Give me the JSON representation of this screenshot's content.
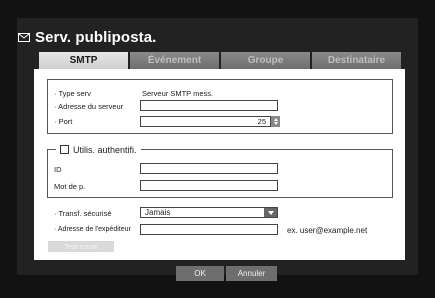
{
  "window": {
    "title": "Serv. publiposta.",
    "icon": "mail-icon"
  },
  "tabs": [
    {
      "label": "SMTP",
      "active": true
    },
    {
      "label": "Événement",
      "active": false
    },
    {
      "label": "Groupe",
      "active": false
    },
    {
      "label": "Destinataire",
      "active": false
    }
  ],
  "smtp": {
    "type_label": "· Type serv",
    "type_value": "Serveur SMTP mess.",
    "address_label": "· Adresse du serveur",
    "address_value": "",
    "port_label": "· Port",
    "port_value": "25"
  },
  "auth": {
    "checkbox_label": "Utilis. authentifi.",
    "checked": false,
    "id_label": "ID",
    "id_value": "",
    "password_label": "Mot de p.",
    "password_value": ""
  },
  "security": {
    "transfer_label": "· Transf. sécurisé",
    "transfer_value": "Jamais",
    "sender_label": "· Adresse de l'expéditeur",
    "sender_value": "",
    "sender_hint": "ex. user@example.net"
  },
  "buttons": {
    "test_email": "Test email",
    "ok": "OK",
    "cancel": "Annuler"
  }
}
